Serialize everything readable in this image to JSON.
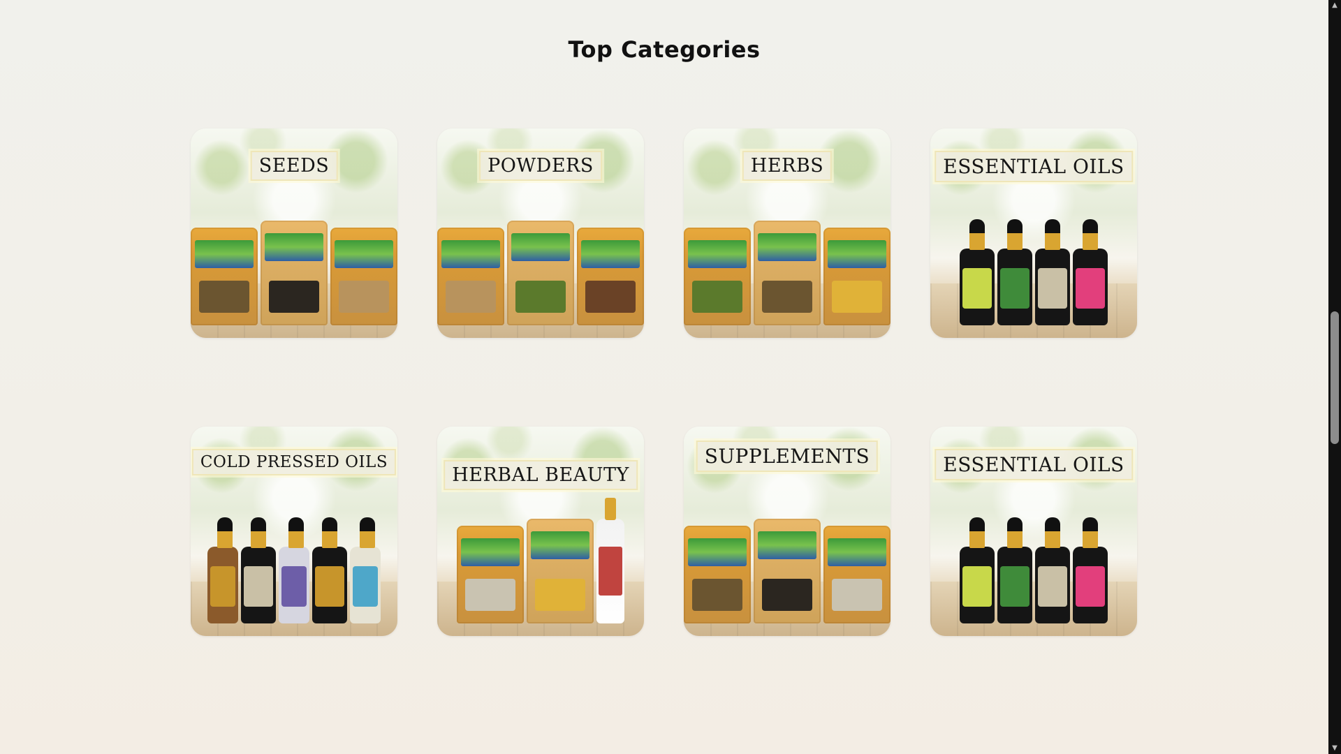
{
  "section": {
    "title": "Top Categories"
  },
  "categories": [
    {
      "label": "SEEDS"
    },
    {
      "label": "POWDERS"
    },
    {
      "label": "HERBS"
    },
    {
      "label": "ESSENTIAL OILS"
    },
    {
      "label": "COLD PRESSED OILS"
    },
    {
      "label": "HERBAL BEAUTY"
    },
    {
      "label": "SUPPLEMENTS"
    },
    {
      "label": "ESSENTIAL OILS"
    }
  ],
  "scrollbar": {
    "up_icon": "▲",
    "down_icon": "▼"
  }
}
